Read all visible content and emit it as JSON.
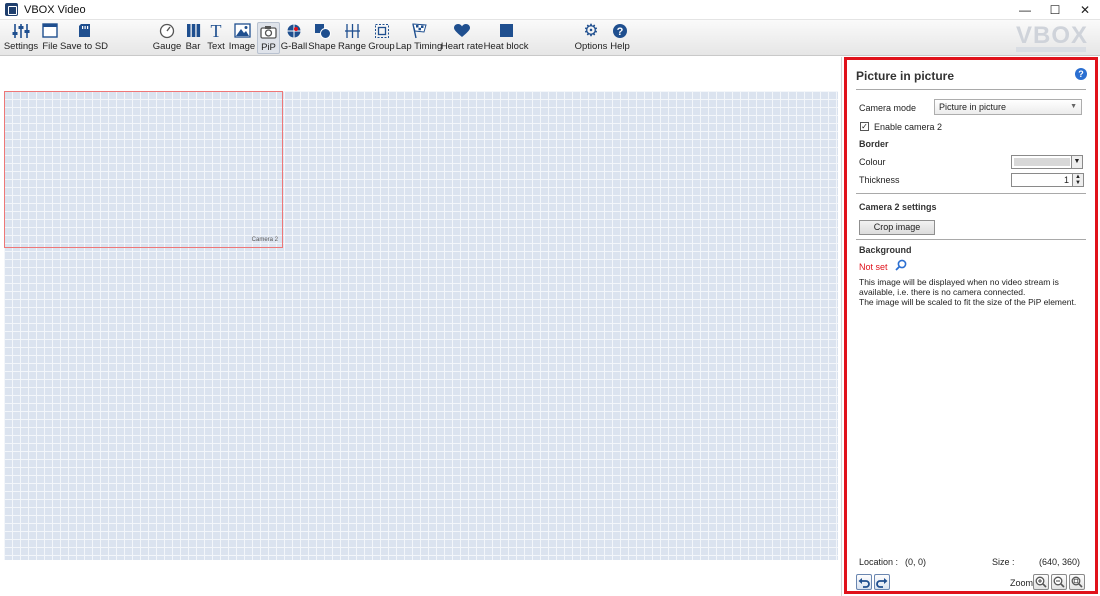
{
  "window": {
    "title": "VBOX Video"
  },
  "toolbar": {
    "items": [
      {
        "label": "Settings"
      },
      {
        "label": "File"
      },
      {
        "label": "Save to SD"
      },
      {
        "label": "Gauge"
      },
      {
        "label": "Bar"
      },
      {
        "label": "Text"
      },
      {
        "label": "Image"
      },
      {
        "label": "PiP"
      },
      {
        "label": "G-Ball"
      },
      {
        "label": "Shape"
      },
      {
        "label": "Range"
      },
      {
        "label": "Group"
      },
      {
        "label": "Lap Timing"
      },
      {
        "label": "Heart rate"
      },
      {
        "label": "Heat block"
      },
      {
        "label": "Options"
      },
      {
        "label": "Help"
      }
    ],
    "logo": "VBOX"
  },
  "canvas": {
    "pip_label": "Camera 2"
  },
  "panel": {
    "title": "Picture in picture",
    "camera_mode_label": "Camera mode",
    "camera_mode_value": "Picture in picture",
    "enable_camera2_label": "Enable camera 2",
    "enable_camera2_checked": true,
    "border_label": "Border",
    "colour_label": "Colour",
    "thickness_label": "Thickness",
    "thickness_value": "1",
    "camera2_settings_label": "Camera 2 settings",
    "crop_button": "Crop image",
    "background_label": "Background",
    "background_value": "Not set",
    "desc_line1": "This image will be displayed when no video stream is available, i.e. there is no camera connected.",
    "desc_line2": "The image will be scaled to fit the size of the PiP element.",
    "location_label": "Location :",
    "location_value": "(0, 0)",
    "size_label": "Size :",
    "size_value": "(640, 360)",
    "zoom_label": "Zoom"
  },
  "colors": {
    "accent": "#2b6fd1",
    "highlight": "#e0121b"
  }
}
